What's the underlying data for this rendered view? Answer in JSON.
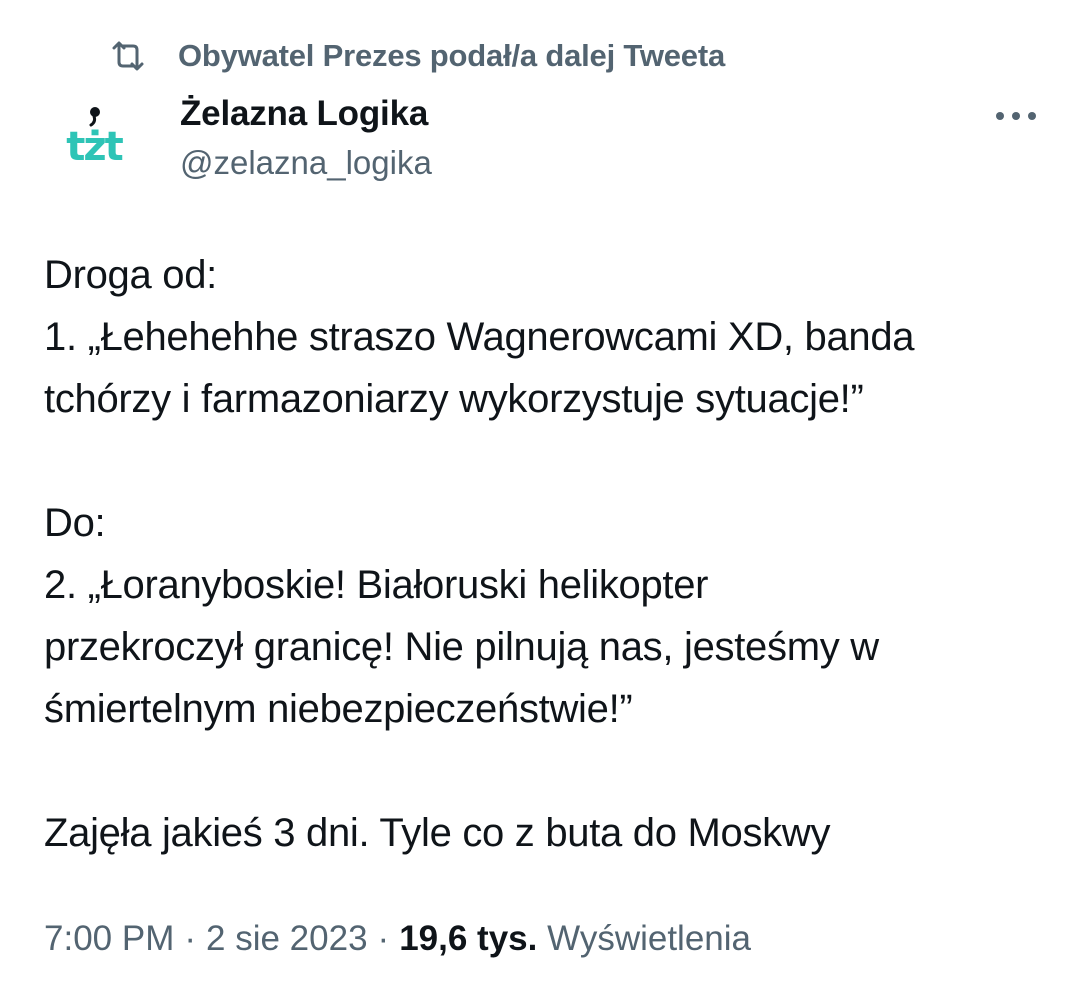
{
  "retweet": {
    "icon": "retweet-icon",
    "text": "Obywatel Prezes podał/a dalej Tweeta"
  },
  "author": {
    "avatar_text": "tżt",
    "avatar_color": "#2ec4b6",
    "display_name": "Żelazna Logika",
    "handle": "@zelazna_logika"
  },
  "more_icon": "more-horizontal-icon",
  "tweet": {
    "lines": [
      "Droga od:",
      "1. „Łehehehhe straszo Wagnerowcami XD, banda",
      "tchórzy i farmazoniarzy wykorzystuje sytuacje!”",
      "",
      "Do:",
      "2. „Łoranyboskie! Białoruski helikopter",
      "przekroczył granicę! Nie pilnują nas, jesteśmy w",
      "śmiertelnym niebezpieczeństwie!”",
      "",
      "Zajęła jakieś 3 dni. Tyle co z buta do Moskwy"
    ]
  },
  "meta": {
    "time": "7:00 PM",
    "date": "2 sie 2023",
    "views_count": "19,6 tys.",
    "views_label": "Wyświetlenia",
    "separator": "·"
  },
  "colors": {
    "text_primary": "#0f1419",
    "text_secondary": "#536471",
    "avatar_teal": "#2ec4b6"
  }
}
